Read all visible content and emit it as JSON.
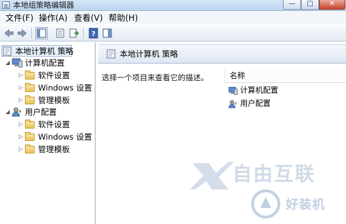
{
  "window": {
    "title": "本地组策略编辑器",
    "min_label": "—",
    "max_label": "□",
    "close_label": "✕"
  },
  "menu": [
    {
      "label": "文件(F)"
    },
    {
      "label": "操作(A)"
    },
    {
      "label": "查看(V)"
    },
    {
      "label": "帮助(H)"
    }
  ],
  "toolbar": {
    "icons": [
      "back-arrow-icon",
      "forward-arrow-icon",
      "show-hide-tree-icon",
      "properties-icon",
      "export-list-icon",
      "help-icon",
      "show-hide-action-pane-icon"
    ]
  },
  "tree": {
    "root": {
      "label": "本地计算机 策略"
    },
    "computer": {
      "label": "计算机配置",
      "children": [
        {
          "label": "软件设置"
        },
        {
          "label": "Windows 设置"
        },
        {
          "label": "管理模板"
        }
      ]
    },
    "user": {
      "label": "用户配置",
      "children": [
        {
          "label": "软件设置"
        },
        {
          "label": "Windows 设置"
        },
        {
          "label": "管理模板"
        }
      ]
    }
  },
  "right": {
    "header_title": "本地计算机 策略",
    "description": "选择一个项目来查看它的描述。",
    "column_header": "名称",
    "items": [
      {
        "label": "计算机配置"
      },
      {
        "label": "用户配置"
      }
    ]
  },
  "watermark": {
    "brand1": "自由互联",
    "brand2": "好装机"
  },
  "colors": {
    "titlebar": "#c9dcf2",
    "folder": "#e9c25a",
    "header_band": "#dde7f3"
  }
}
